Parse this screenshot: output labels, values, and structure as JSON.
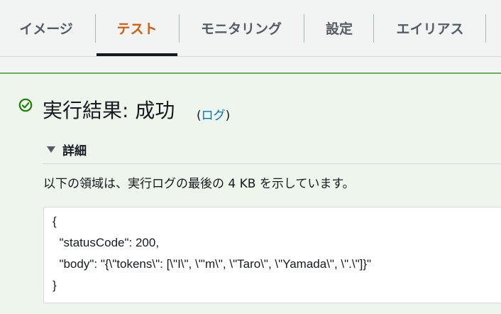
{
  "tabs": [
    {
      "label": "イメージ",
      "active": false
    },
    {
      "label": "テスト",
      "active": true
    },
    {
      "label": "モニタリング",
      "active": false
    },
    {
      "label": "設定",
      "active": false
    },
    {
      "label": "エイリアス",
      "active": false
    }
  ],
  "result": {
    "title": "実行結果: 成功",
    "log_open": "(",
    "log_link": "ログ",
    "log_close": ")",
    "status_color": "#1d8102",
    "icon": "check-circle-icon"
  },
  "details": {
    "toggle_label": "詳細",
    "toggle_icon": "caret-down-icon",
    "description": "以下の領域は、実行ログの最後の 4 KB を示しています。",
    "output_lines": [
      "{",
      "  \"statusCode\": 200,",
      "  \"body\": \"{\\\"tokens\\\": [\\\"I\\\", \\\"'m\\\", \\\"Taro\\\", \\\"Yamada\\\", \\\".\\\"]}\"",
      "}"
    ]
  },
  "colors": {
    "active_tab": "#d45b07",
    "link": "#0073bb",
    "panel_bg": "#eef5ec",
    "panel_border": "#6aaf5c"
  }
}
